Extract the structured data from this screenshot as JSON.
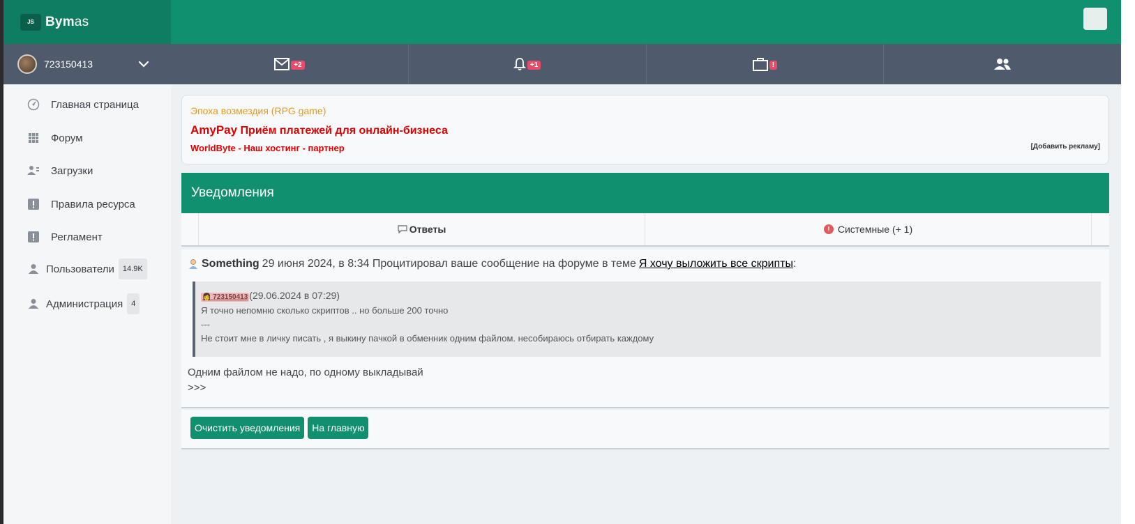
{
  "brand": {
    "badge": "JS",
    "name_bold": "Bym",
    "name_light": "as"
  },
  "user": {
    "name": "723150413"
  },
  "sidebar": {
    "items": [
      {
        "label": "Главная страница",
        "icon": "dashboard-icon"
      },
      {
        "label": "Форум",
        "icon": "grid-icon"
      },
      {
        "label": "Загрузки",
        "icon": "user-group-icon"
      },
      {
        "label": "Правила ресурса",
        "icon": "exclamation-icon"
      },
      {
        "label": "Регламент",
        "icon": "exclamation-icon"
      },
      {
        "label": "Пользователи",
        "icon": "user-icon",
        "badge": "14.9K"
      },
      {
        "label": "Администрация",
        "icon": "user-icon",
        "badge": "4"
      }
    ]
  },
  "iconbar": {
    "mail_count": "+2",
    "bell_count": "+1",
    "case_count": "!"
  },
  "ads": {
    "line1": "Эпоха возмездия (RPG game)",
    "line2_brand": "AmyPay",
    "line2_text": " Приём платежей для онлайн-бизнеса",
    "line3": "WorldByte - Наш хостинг - партнер",
    "add_link": "[Добавить рекламу]"
  },
  "panel": {
    "title": "Уведомления",
    "tabs": {
      "replies": "Ответы",
      "system": "Системные (+ 1)"
    }
  },
  "notification": {
    "author": "Something",
    "date": "29 июня 2024, в 8:34",
    "text": "Процитировал ваше сообщение на форуме в теме",
    "topic": "Я хочу выложить все скрипты",
    "colon": ":",
    "quote": {
      "user": "723150413",
      "date": "(29.06.2024 в 07:29)",
      "line1": "Я точно непомню сколько скриптов .. но больше 200 точно",
      "line2": "---",
      "line3": "Не стоит мне в личку писать , я выкину пачкой в обменник одним файлом. несобираюсь отбирать каждому"
    },
    "reply": "Одним файлом не надо, по одному выкладывай",
    "reply_more": ">>>"
  },
  "buttons": {
    "clear": "Очистить уведомления",
    "home": "На главную"
  },
  "colors": {
    "accent": "#11906f",
    "bar": "#4f5a6c",
    "badge_red": "#e94b6a"
  }
}
